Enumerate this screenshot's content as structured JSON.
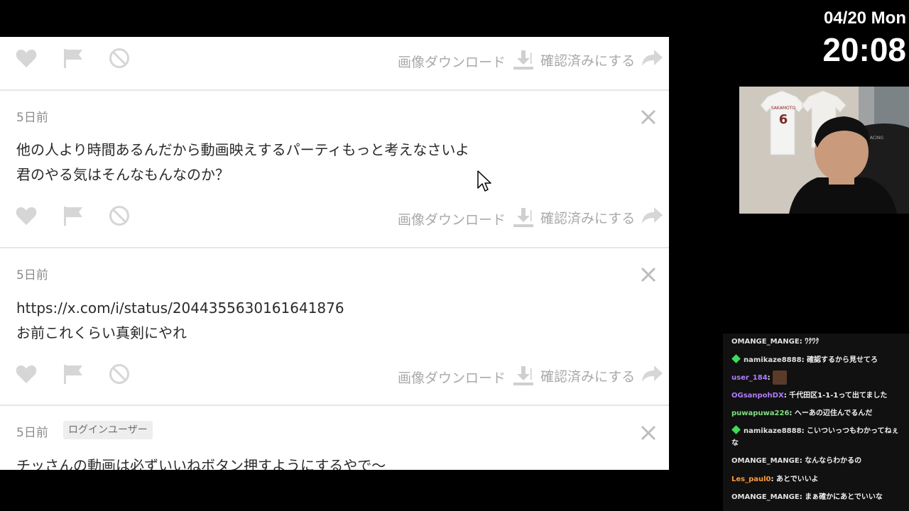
{
  "overlay": {
    "date": "04/20 Mon",
    "time": "20:08"
  },
  "actions": {
    "download_label": "画像ダウンロード",
    "separator": "|",
    "confirm_label": "確認済みにする"
  },
  "comments": [
    {
      "age": "5日前",
      "badge": "",
      "line1": "他の人より時間あるんだから動画映えするパーティもっと考えなさいよ",
      "line2": "君のやる気はそんなもんなのか？"
    },
    {
      "age": "5日前",
      "badge": "",
      "line1": "https://x.com/i/status/2044355630161641876",
      "line2": "お前これくらい真剣にやれ"
    },
    {
      "age": "5日前",
      "badge": "ログインユーザー",
      "line1": "チッさんの動画は必ずいいねボタン押すようにするやで〜",
      "line2": ""
    }
  ],
  "webcam": {
    "jersey_name": "SAKAMOTO",
    "jersey_number": "6",
    "chair_brand": "RACING"
  },
  "chat": {
    "messages": [
      {
        "user": "OMANGE_MANGE",
        "user_color": "#e0e0e0",
        "badge": "",
        "text": "ﾜｸﾜｸ"
      },
      {
        "user": "namikaze8888",
        "user_color": "#e0e0e0",
        "badge": "gem",
        "text": "確認するから見せてろ"
      },
      {
        "user": "user_184",
        "user_color": "#b07cff",
        "badge": "",
        "text": ""
      },
      {
        "user": "OGsanpohDX",
        "user_color": "#b07cff",
        "badge": "",
        "text": "千代田区1-1-1って出てました"
      },
      {
        "user": "puwapuwa226",
        "user_color": "#7fe07f",
        "badge": "",
        "text": "へーあの辺住んでるんだ"
      },
      {
        "user": "namikaze8888",
        "user_color": "#e0e0e0",
        "badge": "gem",
        "text": "こいついっつもわかってねぇな"
      },
      {
        "user": "OMANGE_MANGE",
        "user_color": "#e0e0e0",
        "badge": "",
        "text": "なんならわかるの"
      },
      {
        "user": "Les_paul0",
        "user_color": "#ff9a3c",
        "badge": "",
        "text": "あとでいいよ"
      },
      {
        "user": "OMANGE_MANGE",
        "user_color": "#e0e0e0",
        "badge": "",
        "text": "まぁ確かにあとでいいな"
      }
    ]
  }
}
